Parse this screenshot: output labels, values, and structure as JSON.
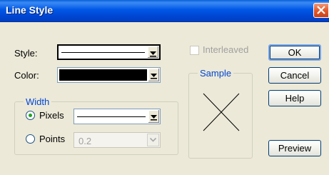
{
  "dialog": {
    "title": "Line Style"
  },
  "fields": {
    "style_label": "Style:",
    "color_label": "Color:",
    "color_value": "#000000"
  },
  "width_group": {
    "legend": "Width",
    "pixels_label": "Pixels",
    "points_label": "Points",
    "points_value": "0.2",
    "selected": "Pixels"
  },
  "interleaved": {
    "label": "Interleaved",
    "checked": false,
    "disabled": true
  },
  "sample": {
    "legend": "Sample"
  },
  "buttons": {
    "ok": "OK",
    "cancel": "Cancel",
    "help": "Help",
    "preview": "Preview"
  },
  "colors": {
    "title_bar": "#0058e6",
    "dialog_bg": "#ece9d8",
    "group_legend": "#0046d5",
    "close_button": "#e25a2c"
  },
  "icons": {
    "close": "close-x-icon",
    "dropdown": "dropdown-arrow-icon"
  }
}
